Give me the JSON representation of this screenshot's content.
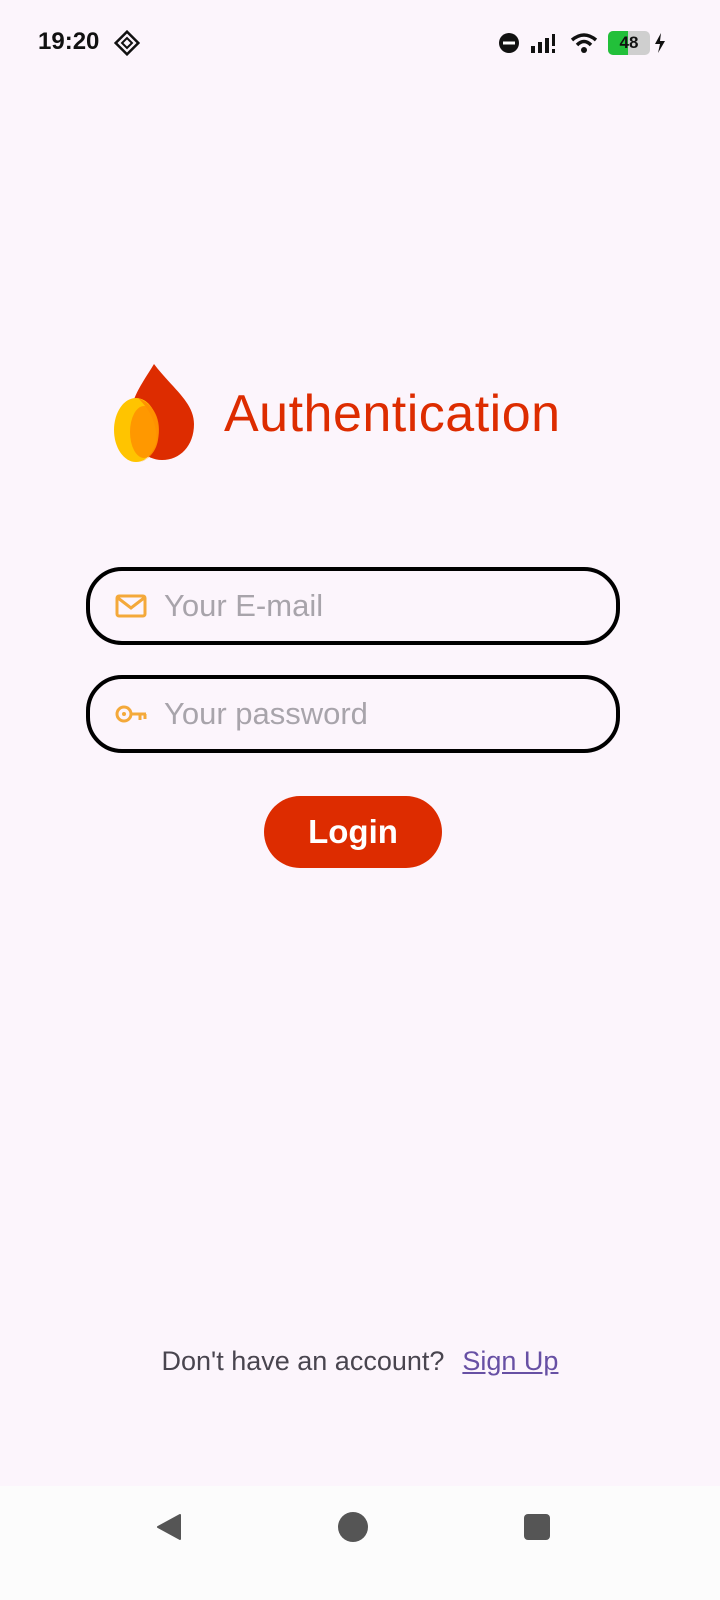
{
  "status_bar": {
    "time": "19:20",
    "battery_level": "48",
    "battery_fraction": 0.48,
    "icons": [
      "dnd-icon",
      "signal-icon",
      "wifi-icon",
      "battery-icon",
      "charging-icon"
    ]
  },
  "header": {
    "title": "Authentication",
    "logo": "firebase-flame-logo"
  },
  "form": {
    "email_placeholder": "Your E-mail",
    "email_value": "",
    "email_icon": "mail-icon",
    "password_placeholder": "Your password",
    "password_value": "",
    "password_icon": "key-icon",
    "login_label": "Login"
  },
  "footer": {
    "signup_prompt": "Don't have an account?",
    "signup_link": "Sign Up"
  },
  "colors": {
    "accent": "#dd2c00",
    "icon_orange": "#f4a93a",
    "link": "#6750a4",
    "background": "#fcf5fc"
  },
  "nav_bar": {
    "buttons": [
      "back-icon",
      "home-icon",
      "recents-icon"
    ]
  }
}
